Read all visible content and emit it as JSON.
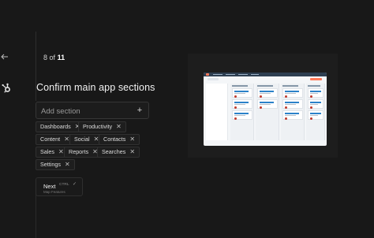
{
  "progress": {
    "current": "8",
    "of_label": "of",
    "total": "11"
  },
  "title": "Confirm main app sections",
  "add_section": {
    "placeholder": "Add section"
  },
  "sections": [
    {
      "label": "Dashboards"
    },
    {
      "label": "Productivity"
    },
    {
      "label": "Content"
    },
    {
      "label": "Social"
    },
    {
      "label": "Contacts"
    },
    {
      "label": "Sales"
    },
    {
      "label": "Reports"
    },
    {
      "label": "Searches"
    },
    {
      "label": "Settings"
    }
  ],
  "next_button": {
    "label": "Next",
    "shortcut": "CTRL",
    "sublabel": "Map Features"
  },
  "icons": {
    "back": "arrow-left-icon",
    "brand": "hubspot-sprocket-icon",
    "add": "plus-icon",
    "remove": "close-icon",
    "next": "check-icon"
  },
  "colors": {
    "background": "#181818",
    "accent": "#ff7a59"
  }
}
